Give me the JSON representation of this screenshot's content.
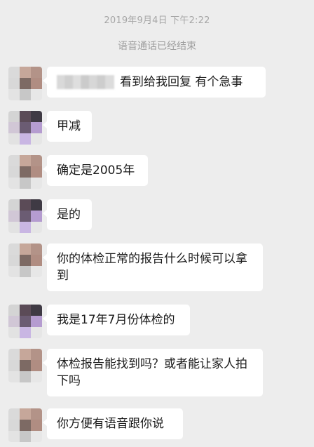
{
  "chat": {
    "timestamp": "2019年9月4日 下午2:22",
    "system_message": "语音通话已经结束",
    "messages": [
      {
        "text": "看到给我回复 有个急事",
        "has_redacted_prefix": true
      },
      {
        "text": "甲减"
      },
      {
        "text": "确定是2005年"
      },
      {
        "text": "是的"
      },
      {
        "text": "你的体检正常的报告什么时候可以拿到"
      },
      {
        "text": "我是17年7月份体检的"
      },
      {
        "text": "体检报告能找到吗？或者能让家人拍下吗"
      },
      {
        "text": "你方便有语音跟你说"
      }
    ]
  },
  "avatars": [
    {
      "style": "brown"
    },
    {
      "style": "purple"
    },
    {
      "style": "brown"
    },
    {
      "style": "purple"
    },
    {
      "style": "brown"
    },
    {
      "style": "purple"
    },
    {
      "style": "brown"
    },
    {
      "style": "brown"
    }
  ]
}
